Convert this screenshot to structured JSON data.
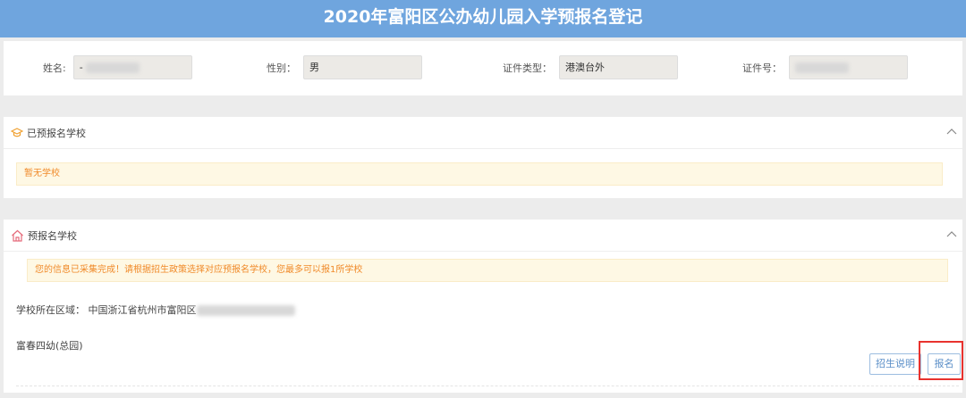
{
  "header": {
    "title": "2020年富阳区公办幼儿园入学预报名登记"
  },
  "info": {
    "name": {
      "label": "姓名:",
      "value": "-"
    },
    "gender": {
      "label": "性别：",
      "value": "男"
    },
    "id_type": {
      "label": "证件类型：",
      "value": "港澳台外"
    },
    "id_number": {
      "label": "证件号：",
      "value": ""
    }
  },
  "registered": {
    "title": "已预报名学校",
    "notice": "暂无学校"
  },
  "apply": {
    "title": "预报名学校",
    "notice": "您的信息已采集完成！请根据招生政策选择对应预报名学校，您最多可以报1所学校",
    "region_label": "学校所在区域：",
    "region_value": "中国浙江省杭州市富阳区",
    "school_name": "富春四幼(总园)",
    "btn_info": "招生说明",
    "btn_apply": "报名"
  },
  "colors": {
    "header": "#6fa5de",
    "notice_text": "#f08a2a",
    "highlight": "#e8322e"
  }
}
